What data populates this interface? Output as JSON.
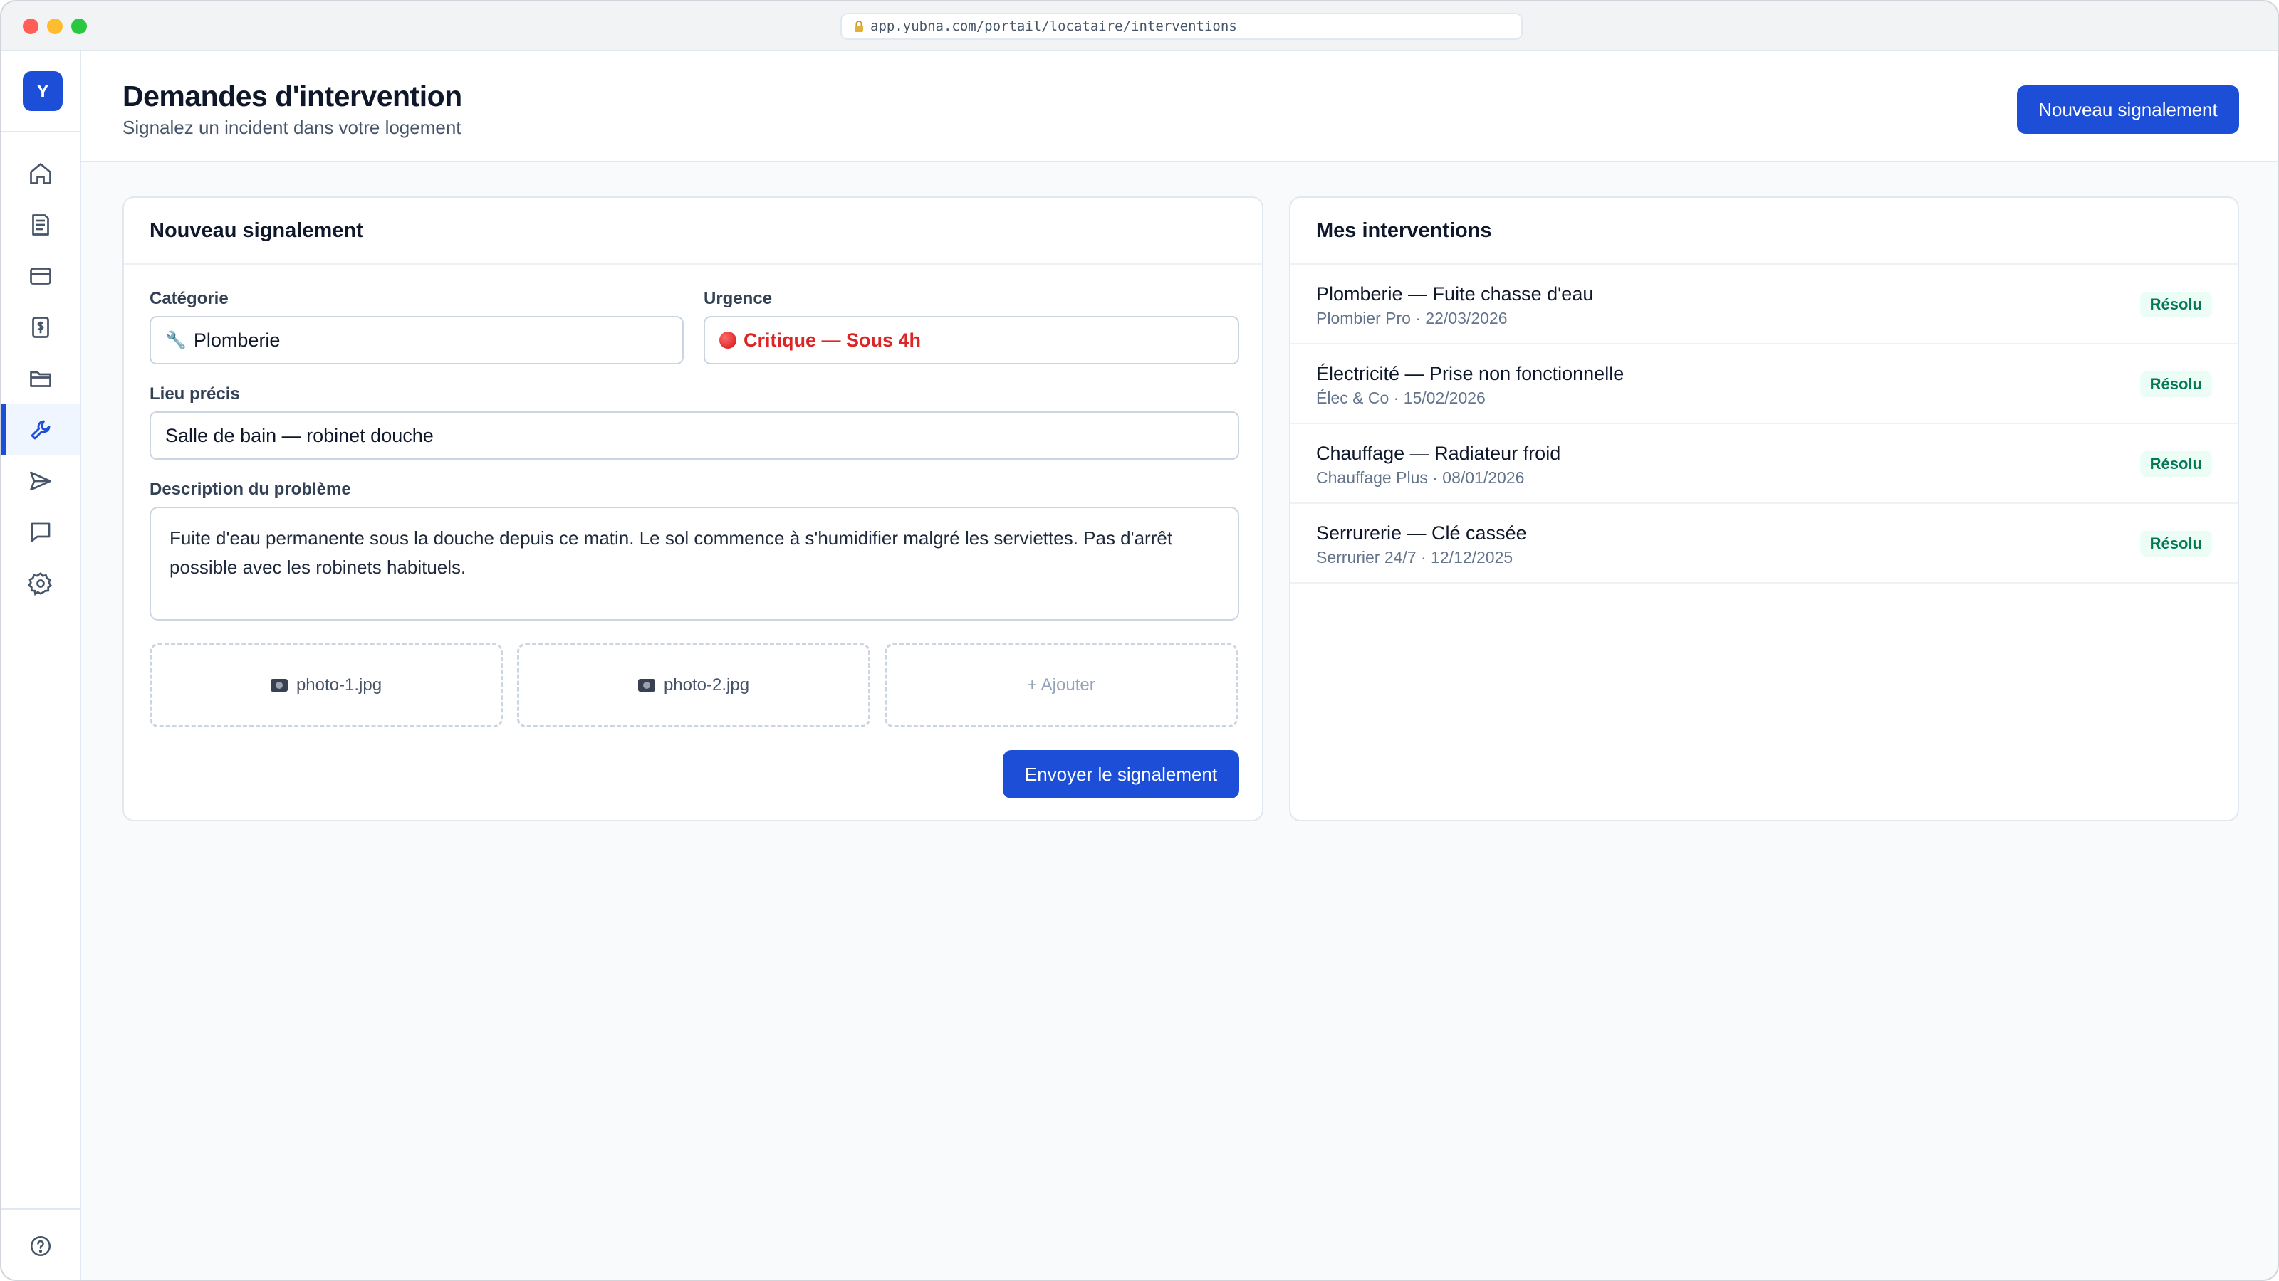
{
  "browser": {
    "url": "app.yubna.com/portail/locataire/interventions"
  },
  "sidebar": {
    "brand": "Y",
    "items": [
      {
        "name": "home-icon",
        "active": false
      },
      {
        "name": "document-icon",
        "active": false
      },
      {
        "name": "credit-card-icon",
        "active": false
      },
      {
        "name": "receipt-icon",
        "active": false
      },
      {
        "name": "folder-icon",
        "active": false
      },
      {
        "name": "wrench-icon",
        "active": true
      },
      {
        "name": "send-icon",
        "active": false
      },
      {
        "name": "message-icon",
        "active": false
      },
      {
        "name": "settings-icon",
        "active": false
      }
    ],
    "help_icon": "help-icon"
  },
  "header": {
    "title": "Demandes d'intervention",
    "subtitle": "Signalez un incident dans votre logement",
    "new_button": "Nouveau signalement"
  },
  "form": {
    "title": "Nouveau signalement",
    "category_label": "Catégorie",
    "category_icon": "🔧",
    "category_value": "Plomberie",
    "urgency_label": "Urgence",
    "urgency_value": "Critique — Sous 4h",
    "location_label": "Lieu précis",
    "location_value": "Salle de bain — robinet douche",
    "description_label": "Description du problème",
    "description_value": "Fuite d'eau permanente sous la douche depuis ce matin. Le sol commence à s'humidifier malgré les serviettes. Pas d'arrêt possible avec les robinets habituels.",
    "attachments": [
      "photo-1.jpg",
      "photo-2.jpg"
    ],
    "add_label": "+ Ajouter",
    "submit_label": "Envoyer le signalement"
  },
  "interventions": {
    "title": "Mes interventions",
    "items": [
      {
        "title": "Plomberie — Fuite chasse d'eau",
        "meta": "Plombier Pro · 22/03/2026",
        "status": "Résolu"
      },
      {
        "title": "Électricité — Prise non fonctionnelle",
        "meta": "Élec & Co · 15/02/2026",
        "status": "Résolu"
      },
      {
        "title": "Chauffage — Radiateur froid",
        "meta": "Chauffage Plus · 08/01/2026",
        "status": "Résolu"
      },
      {
        "title": "Serrurerie — Clé cassée",
        "meta": "Serrurier 24/7 · 12/12/2025",
        "status": "Résolu"
      }
    ]
  },
  "colors": {
    "accent": "#1d4ed8",
    "critical": "#dc2626",
    "success_text": "#047857",
    "success_bg": "#ecfdf5"
  }
}
